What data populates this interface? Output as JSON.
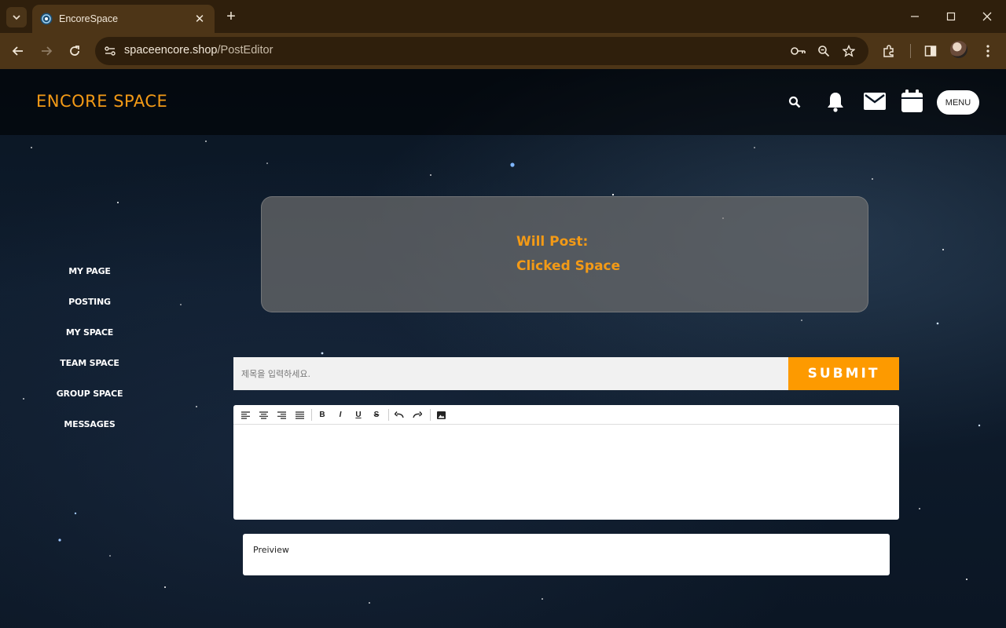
{
  "browser": {
    "tab_title": "EncoreSpace",
    "url_host": "spaceencore.shop",
    "url_path": "/PostEditor",
    "new_tab_label": "+",
    "tab_close_label": "✕"
  },
  "header": {
    "logo": "ENCORE SPACE",
    "menu_label": "MENU"
  },
  "sidebar": {
    "items": [
      {
        "label": "MY PAGE"
      },
      {
        "label": "POSTING"
      },
      {
        "label": "MY SPACE"
      },
      {
        "label": "TEAM SPACE"
      },
      {
        "label": "GROUP SPACE"
      },
      {
        "label": "MESSAGES"
      }
    ]
  },
  "post_info": {
    "line1": "Will Post:",
    "line2": "Clicked Space"
  },
  "form": {
    "title_placeholder": "제목을 입력하세요.",
    "submit_label": "SUBMIT"
  },
  "editor": {
    "bold": "B",
    "italic": "I",
    "underline": "U",
    "strike": "S"
  },
  "preview": {
    "label": "Preiview"
  },
  "colors": {
    "accent": "#f39a16",
    "submit_bg": "#fd9a00",
    "chrome": "#4d3517"
  }
}
